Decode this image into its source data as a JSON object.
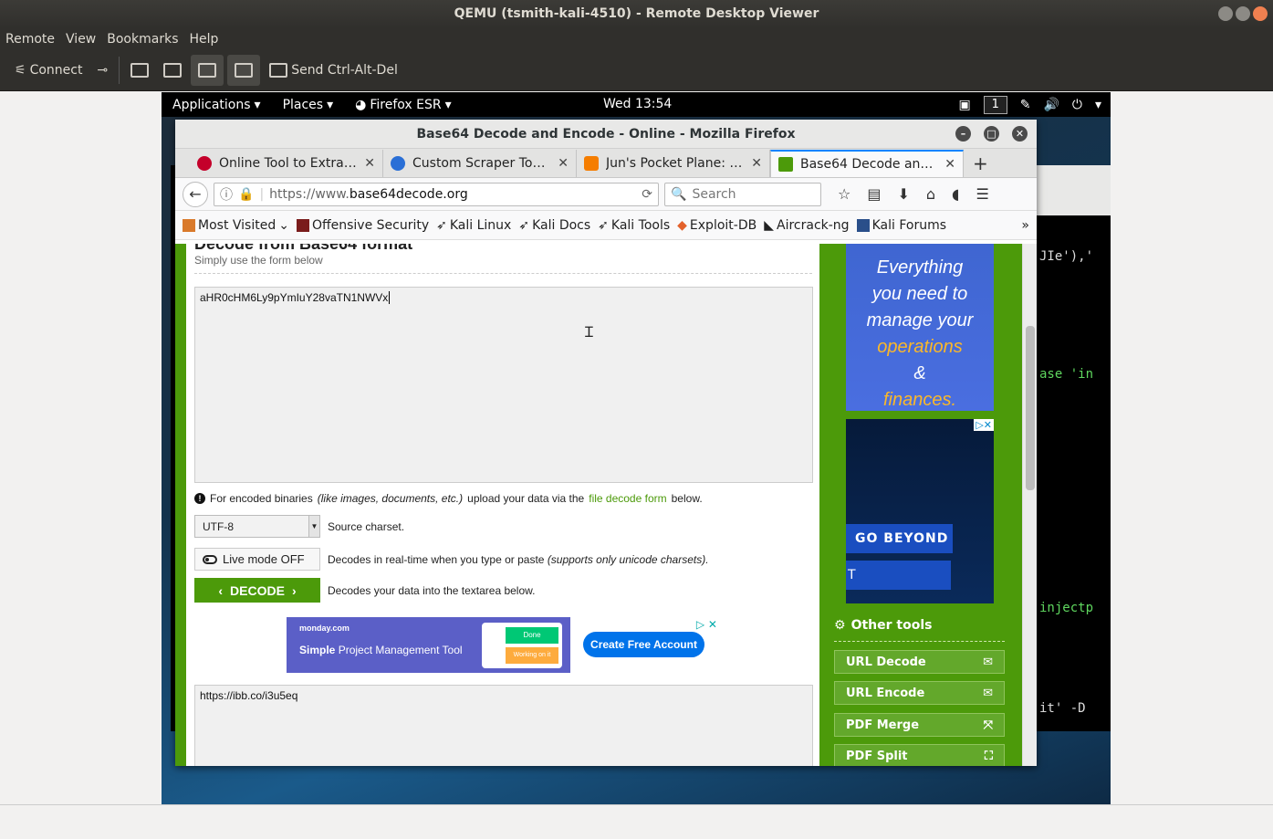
{
  "window": {
    "title": "QEMU (tsmith-kali-4510) - Remote Desktop Viewer"
  },
  "menubar": [
    "Remote",
    "View",
    "Bookmarks",
    "Help"
  ],
  "toolbar": {
    "connect": "Connect",
    "send_cad": "Send Ctrl-Alt-Del"
  },
  "kali": {
    "applications": "Applications",
    "places": "Places",
    "firefox_esr": "Firefox ESR",
    "clock": "Wed 13:54",
    "workspace": "1"
  },
  "terminal": {
    "line1": "JIe'),'",
    "line2": "ase 'in",
    "line3": "injectp",
    "line4": "it' -D"
  },
  "firefox": {
    "title": "Base64 Decode and Encode - Online - Mozilla Firefox",
    "tabs": [
      {
        "label": "Online Tool to Extract...",
        "color": "#c4002a"
      },
      {
        "label": "Custom Scraper Tool ...",
        "color": "#2a6fd6"
      },
      {
        "label": "Jun's Pocket Plane: W...",
        "color": "#f57d00"
      },
      {
        "label": "Base64 Decode and E...",
        "color": "#4c9a0a"
      }
    ],
    "url_prefix": "https://www.",
    "url_domain": "base64decode.org",
    "search_placeholder": "Search",
    "bookmarks": [
      "Most Visited",
      "Offensive Security",
      "Kali Linux",
      "Kali Docs",
      "Kali Tools",
      "Exploit-DB",
      "Aircrack-ng",
      "Kali Forums"
    ],
    "overflow": "»"
  },
  "page": {
    "heading": "Decode from Base64 format",
    "subtitle": "Simply use the form below",
    "input_value": "aHR0cHM6Ly9pYmIuY28vaTN1NWVx",
    "info_pre": "For encoded binaries",
    "info_italic": "(like images, documents, etc.)",
    "info_mid": "upload your data via the",
    "info_link": "file decode form",
    "info_post": "below.",
    "charset_value": "UTF-8",
    "charset_label": "Source charset.",
    "live_label": "Live mode OFF",
    "live_desc": "Decodes in real-time when you type or paste",
    "live_desc_italic": "(supports only unicode charsets).",
    "decode_label": "DECODE",
    "decode_desc": "Decodes your data into the textarea below.",
    "output_value": "https://ibb.co/i3u5eq",
    "ad": {
      "brand": "monday.com",
      "headline_bold": "Simple",
      "headline_rest": "Project Management Tool",
      "done": "Done",
      "working": "Working on it",
      "cta": "Create Free Account"
    }
  },
  "sidebar": {
    "ad1_lines": [
      "Everything",
      "you need to",
      "manage your"
    ],
    "ad1_highlight1": "operations",
    "ad1_amp": "&",
    "ad1_highlight2": "finances.",
    "ad2_go": "GO BEYOND",
    "ad2_t": "T",
    "other_tools": "Other tools",
    "tools": [
      "URL Decode",
      "URL Encode",
      "PDF Merge",
      "PDF Split"
    ]
  }
}
